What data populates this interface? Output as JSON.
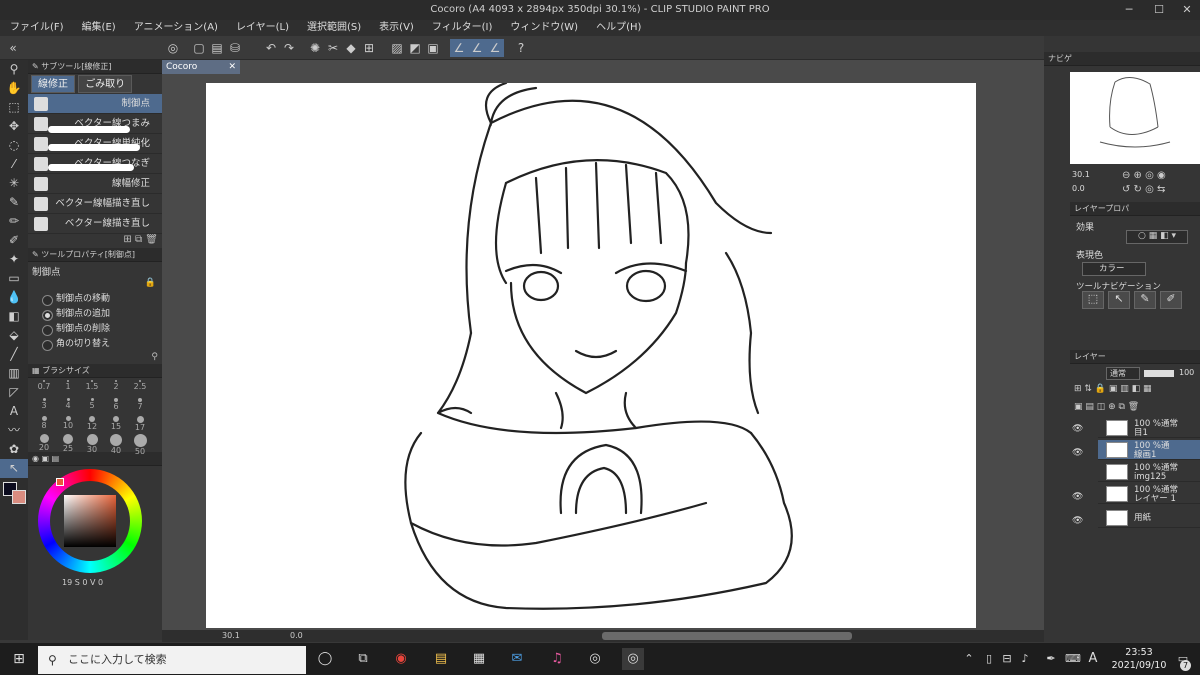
{
  "window": {
    "title": "Cocoro (A4 4093 x 2894px 350dpi 30.1%) - CLIP STUDIO PAINT PRO",
    "min": "─",
    "max": "☐",
    "close": "✕"
  },
  "menu": [
    "ファイル(F)",
    "編集(E)",
    "アニメーション(A)",
    "レイヤー(L)",
    "選択範囲(S)",
    "表示(V)",
    "フィルター(I)",
    "ウィンドウ(W)",
    "ヘルプ(H)"
  ],
  "left": {
    "subtool_header": "サブツール[線修正]",
    "tabs": [
      "線修正",
      "ごみ取り"
    ],
    "subtools": [
      "制御点",
      "ベクター線つまみ",
      "ベクター線単純化",
      "ベクター線つなぎ",
      "線幅修正",
      "ベクター線幅描き直し",
      "ベクター線描き直し"
    ],
    "toolprop_header": "ツールプロパティ[制御点]",
    "toolprop_title": "制御点",
    "options": [
      "制御点の移動",
      "制御点の追加",
      "制御点の削除",
      "角の切り替え"
    ],
    "brush_header": "ブラシサイズ",
    "brush_sizes": [
      "0.7",
      "1",
      "1.5",
      "2",
      "2.5",
      "3",
      "4",
      "5",
      "6",
      "7",
      "8",
      "10",
      "12",
      "15",
      "17",
      "20",
      "25",
      "30",
      "40",
      "50"
    ],
    "color_bottom": "19 S    0 V    0"
  },
  "canvas": {
    "doc_tab": "Cocoro",
    "zoom": "30.1",
    "angle": "0.0"
  },
  "right": {
    "navigator_tab": "ナビゲ",
    "nav_zoom": "30.1",
    "nav_angle": "0.0",
    "layerprop_tab": "レイヤープロパ",
    "effect_label": "効果",
    "color_label": "表現色",
    "color_value": "カラー",
    "toolnav_label": "ツールナビゲーション",
    "layer_tab": "レイヤー",
    "blend_mode": "通常",
    "opacity": "100",
    "layers": [
      {
        "line1": "100 %通常",
        "line2": "目1",
        "selected": false
      },
      {
        "line1": "100 %通",
        "line2": "線画1",
        "selected": true
      },
      {
        "line1": "100 %通常",
        "line2": "img125",
        "selected": false
      },
      {
        "line1": "100 %通常",
        "line2": "レイヤー 1",
        "selected": false
      },
      {
        "line1": "",
        "line2": "用紙",
        "selected": false
      }
    ]
  },
  "taskbar": {
    "search_placeholder": "ここに入力して検索",
    "time": "23:53",
    "date": "2021/09/10",
    "ime": "A",
    "badge": "7"
  }
}
